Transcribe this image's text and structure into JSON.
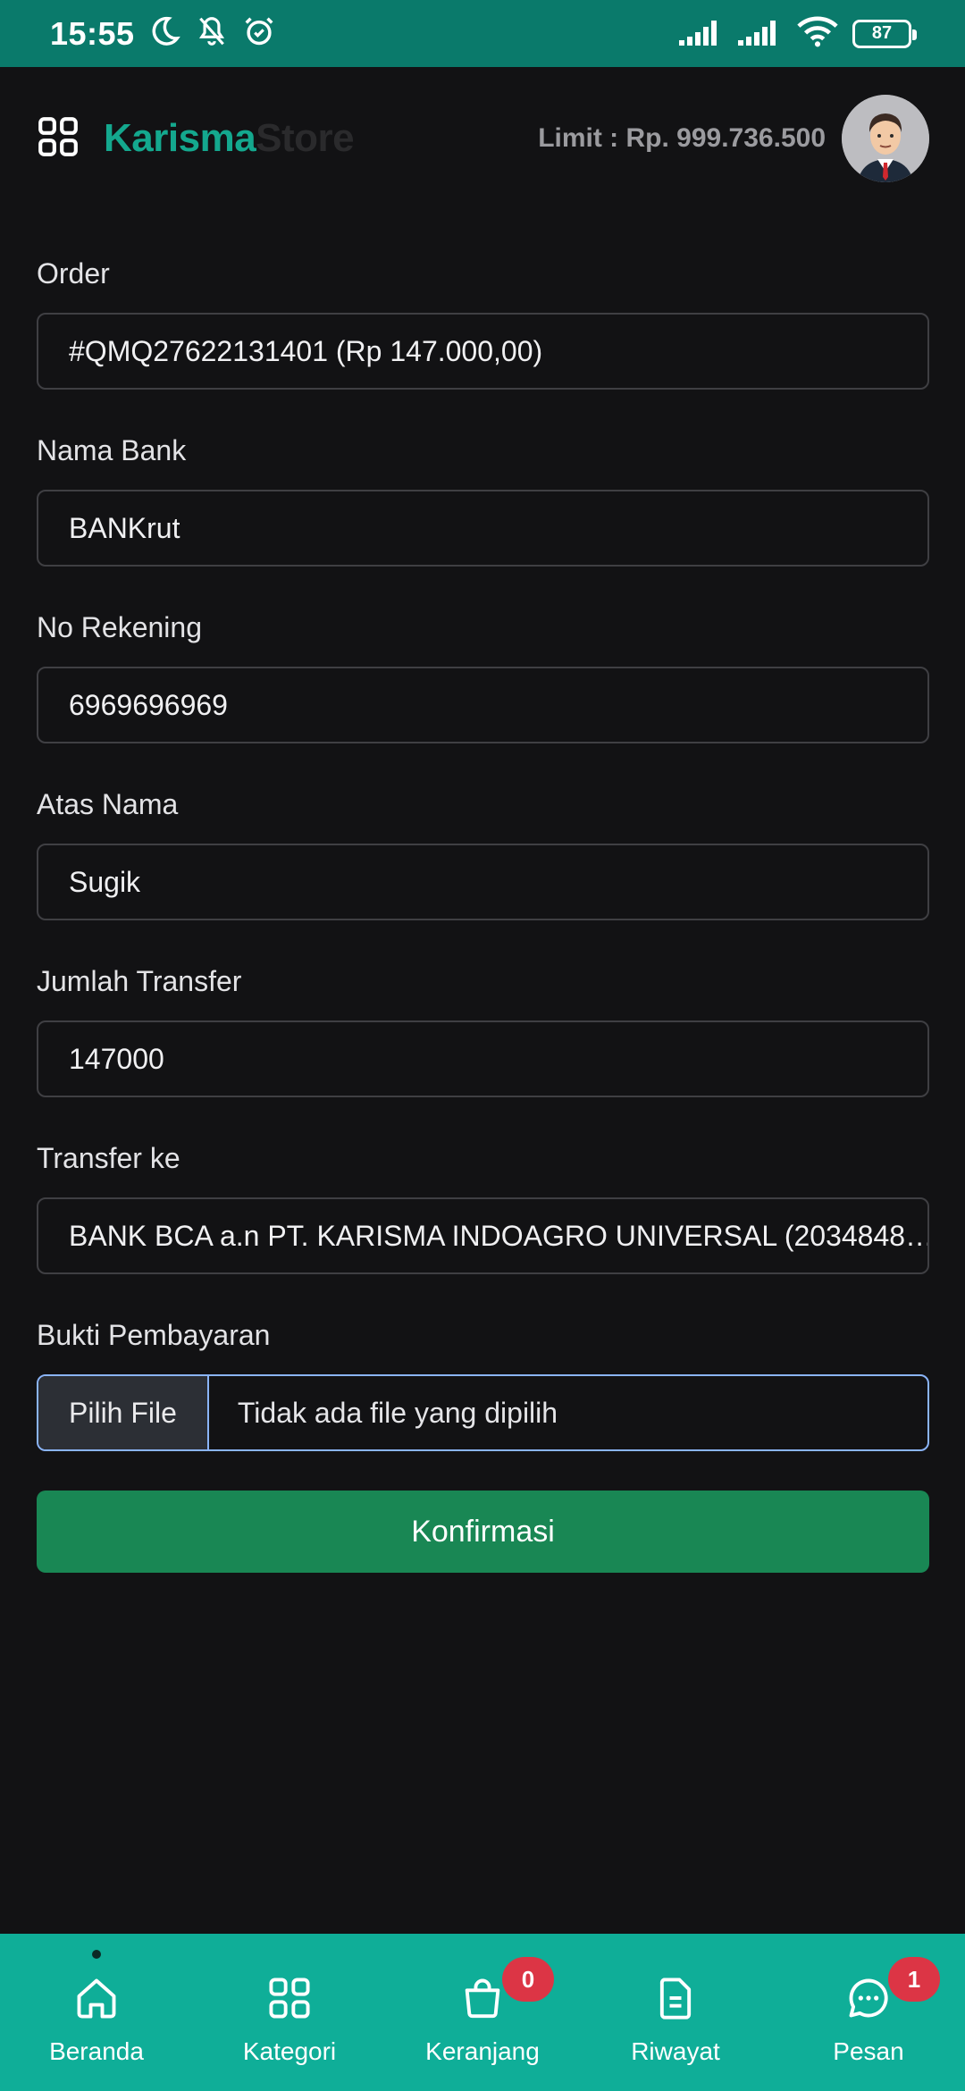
{
  "status_bar": {
    "time": "15:55",
    "battery": "87"
  },
  "header": {
    "brand_part1": "Karisma",
    "brand_part2": "Store",
    "limit_text": "Limit : Rp. 999.736.500"
  },
  "form": {
    "order": {
      "label": "Order",
      "value": "#QMQ27622131401 (Rp 147.000,00)"
    },
    "bank_name": {
      "label": "Nama Bank",
      "value": "BANKrut"
    },
    "account_number": {
      "label": "No Rekening",
      "value": "6969696969"
    },
    "account_holder": {
      "label": "Atas Nama",
      "value": "Sugik"
    },
    "transfer_amount": {
      "label": "Jumlah Transfer",
      "value": "147000"
    },
    "transfer_to": {
      "label": "Transfer ke",
      "value": "BANK BCA a.n PT. KARISMA INDOAGRO UNIVERSAL (2034848…"
    },
    "payment_proof": {
      "label": "Bukti Pembayaran",
      "button_label": "Pilih File",
      "status_text": "Tidak ada file yang dipilih"
    },
    "confirm_label": "Konfirmasi"
  },
  "bottom_nav": {
    "items": [
      {
        "label": "Beranda",
        "icon": "home-icon"
      },
      {
        "label": "Kategori",
        "icon": "grid-icon"
      },
      {
        "label": "Keranjang",
        "icon": "shopping-bag-icon",
        "badge": "0"
      },
      {
        "label": "Riwayat",
        "icon": "document-icon"
      },
      {
        "label": "Pesan",
        "icon": "chat-icon",
        "badge": "1"
      }
    ]
  },
  "colors": {
    "status_bar": "#0a7a6b",
    "background": "#121214",
    "brand_accent": "#14a88e",
    "bottom_nav": "#0fae98",
    "confirm_button": "#198754",
    "badge": "#dc3545",
    "file_focus_border": "#8ab4f8"
  }
}
